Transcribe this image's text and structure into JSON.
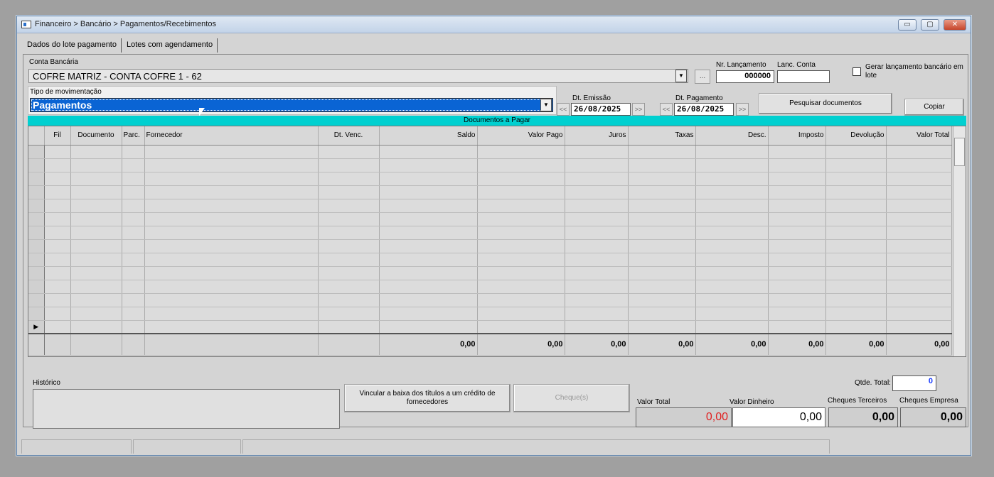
{
  "window": {
    "title": "Financeiro > Bancário > Pagamentos/Recebimentos"
  },
  "tabs": [
    {
      "label": "Dados do lote pagamento"
    },
    {
      "label": "Lotes com agendamento"
    }
  ],
  "form": {
    "conta_bancaria_label": "Conta Bancária",
    "conta_bancaria_value": "COFRE MATRIZ - CONTA COFRE 1 - 62",
    "ellipsis_label": "...",
    "nr_lancamento_label": "Nr. Lançamento",
    "nr_lancamento_value": "000000",
    "lanc_conta_label": "Lanc. Conta",
    "lanc_conta_value": "",
    "gerar_label": "Gerar lançamento bancário em lote",
    "tipo_label": "Tipo de movimentação",
    "tipo_value": "Pagamentos",
    "dt_emissao_label": "Dt. Emissão",
    "dt_emissao_value": "26/08/2025",
    "dt_pagamento_label": "Dt. Pagamento",
    "dt_pagamento_value": "26/08/2025",
    "prev_label": "<<",
    "next_label": ">>",
    "pesquisar_label": "Pesquisar documentos",
    "copiar_label": "Copiar"
  },
  "grid": {
    "caption": "Documentos a Pagar",
    "columns": [
      "Fil",
      "Documento",
      "Parc.",
      "Fornecedor",
      "Dt. Venc.",
      "Saldo",
      "Valor Pago",
      "Juros",
      "Taxas",
      "Desc.",
      "Imposto",
      "Devolução",
      "Valor Total"
    ],
    "current_row_marker": "▶",
    "totals": [
      "0,00",
      "0,00",
      "0,00",
      "0,00",
      "0,00",
      "0,00",
      "0,00",
      "0,00"
    ]
  },
  "bottom": {
    "historico_label": "Histórico",
    "vincular_label": "Vincular a baixa dos títulos a um crédito de fornecedores",
    "cheques_label": "Cheque(s)",
    "qtde_total_label": "Qtde. Total:",
    "qtde_total_value": "0",
    "valor_total_label": "Valor Total",
    "valor_total_value": "0,00",
    "valor_dinheiro_label": "Valor Dinheiro",
    "valor_dinheiro_value": "0,00",
    "cheques_terceiros_label": "Cheques Terceiros",
    "cheques_terceiros_value": "0,00",
    "cheques_empresa_label": "Cheques Empresa",
    "cheques_empresa_value": "0,00"
  },
  "colors": {
    "selection": "#0a64d4",
    "grid_caption": "#00d0d0",
    "valor_total_text": "#e02020",
    "qtde_text": "#1a3cff"
  }
}
